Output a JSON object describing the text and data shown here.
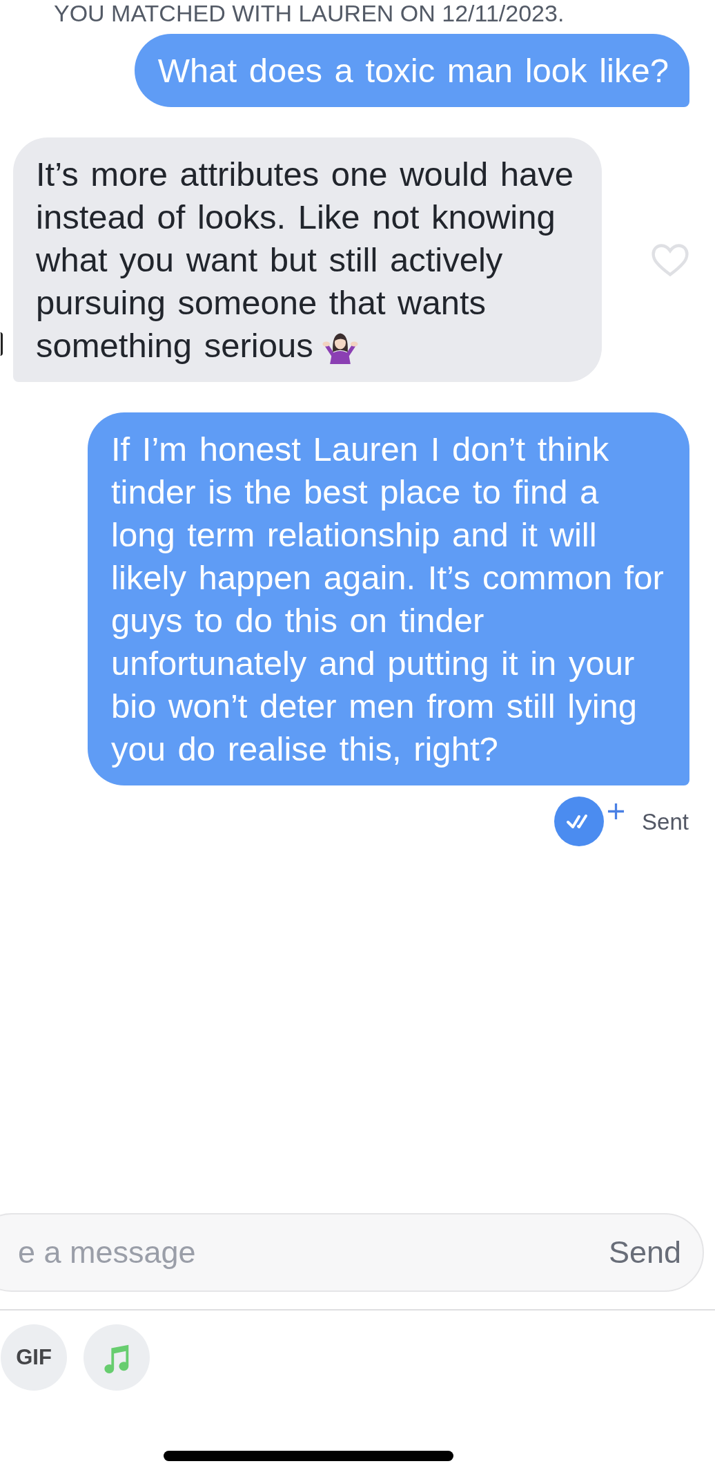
{
  "match_banner": "YOU MATCHED WITH LAUREN ON 12/11/2023.",
  "messages": [
    {
      "kind": "sent",
      "text": "What does a toxic man look like?",
      "has_emoji": false
    },
    {
      "kind": "received",
      "text": "It’s more attributes one would have instead of looks. Like not knowing what you want but still actively pursuing someone that wants something serious",
      "has_emoji": true,
      "liked": false
    },
    {
      "kind": "sent",
      "text": "If I’m honest Lauren I don’t think tinder is the best place to find a long term relationship and it will likely happen again. It’s common for guys to do this on tinder unfortunately and putting it in your bio won’t deter men from still lying you do realise this, right?",
      "has_emoji": false
    }
  ],
  "status": {
    "label": "Sent"
  },
  "composer": {
    "placeholder": "e a message",
    "send_label": "Send"
  },
  "toolbar": [
    {
      "kind": "gif",
      "label": "GIF"
    },
    {
      "kind": "music"
    }
  ]
}
